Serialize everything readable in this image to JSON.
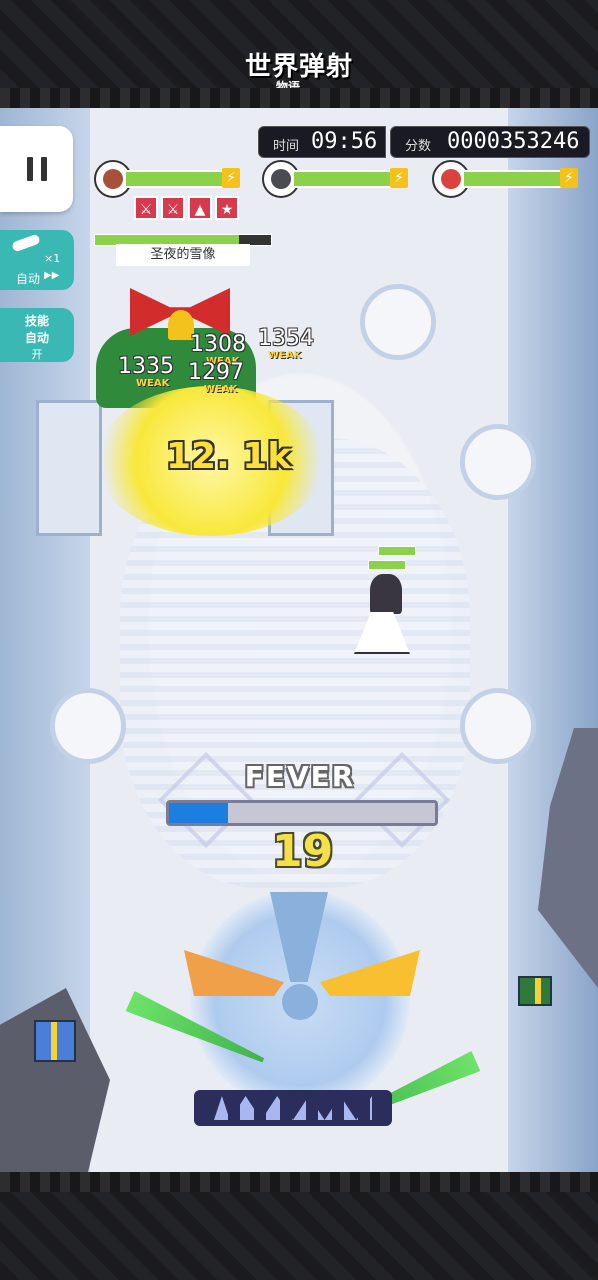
{
  "app": {
    "logo_text": "世界弹射",
    "logo_sub": "物语"
  },
  "hud": {
    "time_label": "时间",
    "time_value": "09:56",
    "score_label": "分数",
    "score_value": "0000353246"
  },
  "party": [
    {
      "name": "unit-1",
      "hp": 0.93,
      "color": "#a8503a"
    },
    {
      "name": "unit-2",
      "hp": 0.95,
      "color": "#4b4b52"
    },
    {
      "name": "unit-3",
      "hp": 0.97,
      "color": "#d9433e"
    }
  ],
  "buffs": [
    "⚔",
    "⚔",
    "▲",
    "★"
  ],
  "side": {
    "auto_label": "自动",
    "auto_count": "×1",
    "auto_arrows": "▶▶",
    "skill_label_1": "技能",
    "skill_label_2": "自动",
    "skill_state": "开"
  },
  "boss": {
    "name": "圣夜的雪像",
    "hp": 0.82
  },
  "damage": {
    "big": "12. 1k",
    "numbers": [
      "1308",
      "1354",
      "1335",
      "1297"
    ],
    "weak_label": "WEAK"
  },
  "fever": {
    "title": "FEVER",
    "progress": 0.22
  },
  "combo": "19",
  "colors": {
    "accent": "#3ab8b4",
    "hp": "#8bd14a",
    "fever": "#1b7fe0",
    "combo": "#f4e14a"
  }
}
